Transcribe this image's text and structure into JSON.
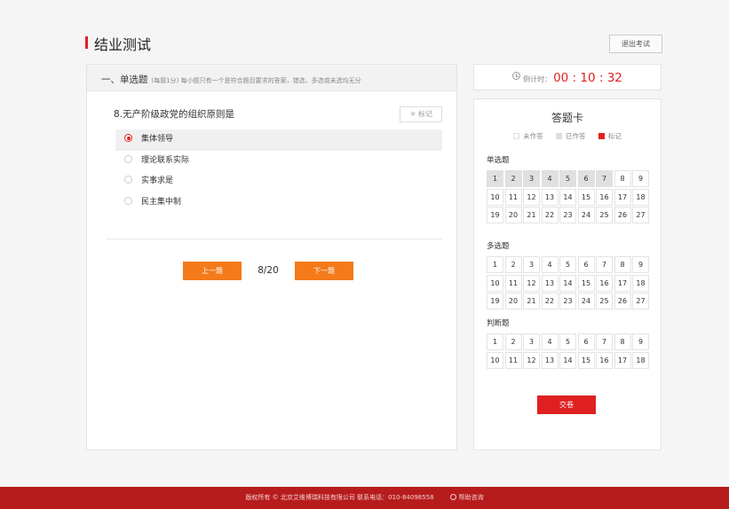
{
  "header": {
    "title": "结业测试",
    "exit_label": "退出考试"
  },
  "section": {
    "title": "一、单选题",
    "desc": "(每题1分) 每小题只有一个是符合题目要求的答案，错选、多选或未选均无分"
  },
  "question": {
    "text": "8.无产阶级政党的组织原则是",
    "mark_label": "标记",
    "options": [
      {
        "label": "集体领导",
        "selected": true
      },
      {
        "label": "理论联系实际",
        "selected": false
      },
      {
        "label": "实事求是",
        "selected": false
      },
      {
        "label": "民主集中制",
        "selected": false
      }
    ]
  },
  "nav": {
    "prev_label": "上一题",
    "next_label": "下一题",
    "page": "8/20"
  },
  "timer": {
    "label": "倒计时：",
    "value": "00 : 10 : 32"
  },
  "card": {
    "title": "答题卡",
    "legend": {
      "unanswered": "未作答",
      "answered": "已作答",
      "marked": "标记"
    },
    "groups": [
      {
        "label": "单选题",
        "count": 27,
        "answered": [
          1,
          2,
          3,
          4,
          5,
          6,
          7
        ]
      },
      {
        "label": "多选题",
        "count": 27,
        "answered": []
      },
      {
        "label": "判断题",
        "count": 18,
        "answered": []
      }
    ],
    "submit_label": "交卷"
  },
  "footer": {
    "copyright": "版权所有 © 北京艾维博瑞科技有限公司  联系电话：010-84098558",
    "help": "帮助咨询"
  },
  "colors": {
    "accent": "#e02020",
    "nav_button": "#f47a1a",
    "footer": "#b71c1c"
  }
}
